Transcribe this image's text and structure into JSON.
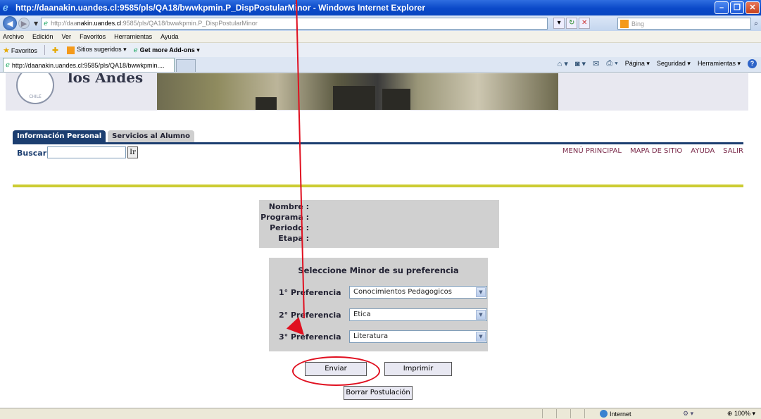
{
  "window": {
    "title": "http://daanakin.uandes.cl:9585/pls/QA18/bwwkpmin.P_DispPostularMinor - Windows Internet Explorer"
  },
  "address": {
    "url_prefix": "http://daa",
    "url_host": "nakin.uandes.cl",
    "url_path": ":9585/pls/QA18/bwwkpmin.P_DispPostularMinor",
    "search_placeholder": "Bing"
  },
  "menu": [
    "Archivo",
    "Edición",
    "Ver",
    "Favoritos",
    "Herramientas",
    "Ayuda"
  ],
  "favorites": {
    "label": "Favoritos",
    "suggested": "Sitios sugeridos",
    "addons": "Get more Add-ons"
  },
  "browser_tab": {
    "title": "http://daanakin.uandes.cl:9585/pls/QA18/bwwkpmin...."
  },
  "command_bar": {
    "page": "Página",
    "security": "Seguridad",
    "tools": "Herramientas"
  },
  "site": {
    "brand": "los Andes",
    "tabs": [
      "Información Personal",
      "Servicios al Alumno"
    ],
    "search_label": "Buscar",
    "search_button": "Ir",
    "top_links": [
      "MENÚ PRINCIPAL",
      "MAPA DE SITIO",
      "AYUDA",
      "SALIR"
    ]
  },
  "info": {
    "labels": [
      "Nombre :",
      "Programa :",
      "Periodo :",
      "Etapa :"
    ]
  },
  "minor": {
    "title": "Seleccione Minor de su preferencia",
    "preferences": [
      {
        "label": "1° Preferencia",
        "value": "Conocimientos Pedagogicos"
      },
      {
        "label": "2° Preferencia",
        "value": "Etica"
      },
      {
        "label": "3° Preferencia",
        "value": "Literatura"
      }
    ]
  },
  "buttons": {
    "send": "Enviar",
    "print": "Imprimir",
    "delete": "Borrar Postulación"
  },
  "status": {
    "zone": "Internet",
    "zoom": "100%"
  },
  "colors": {
    "nav_dark": "#1c3e70",
    "gold_rule": "#cccc33",
    "link": "#7a2a4a",
    "annotation_red": "#e01020"
  }
}
